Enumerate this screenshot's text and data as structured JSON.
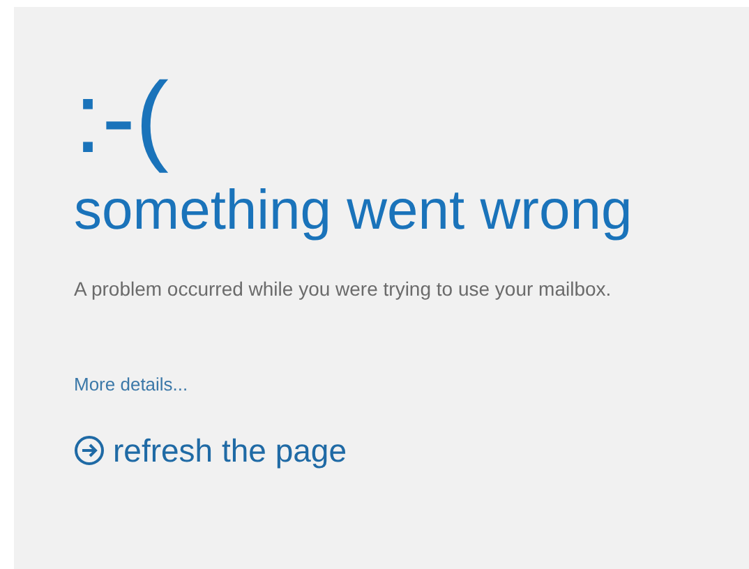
{
  "emoticon": ":-(",
  "heading": "something went wrong",
  "message": "A problem occurred while you were trying to use your mailbox.",
  "details_link": "More details...",
  "refresh_link": "refresh the page"
}
